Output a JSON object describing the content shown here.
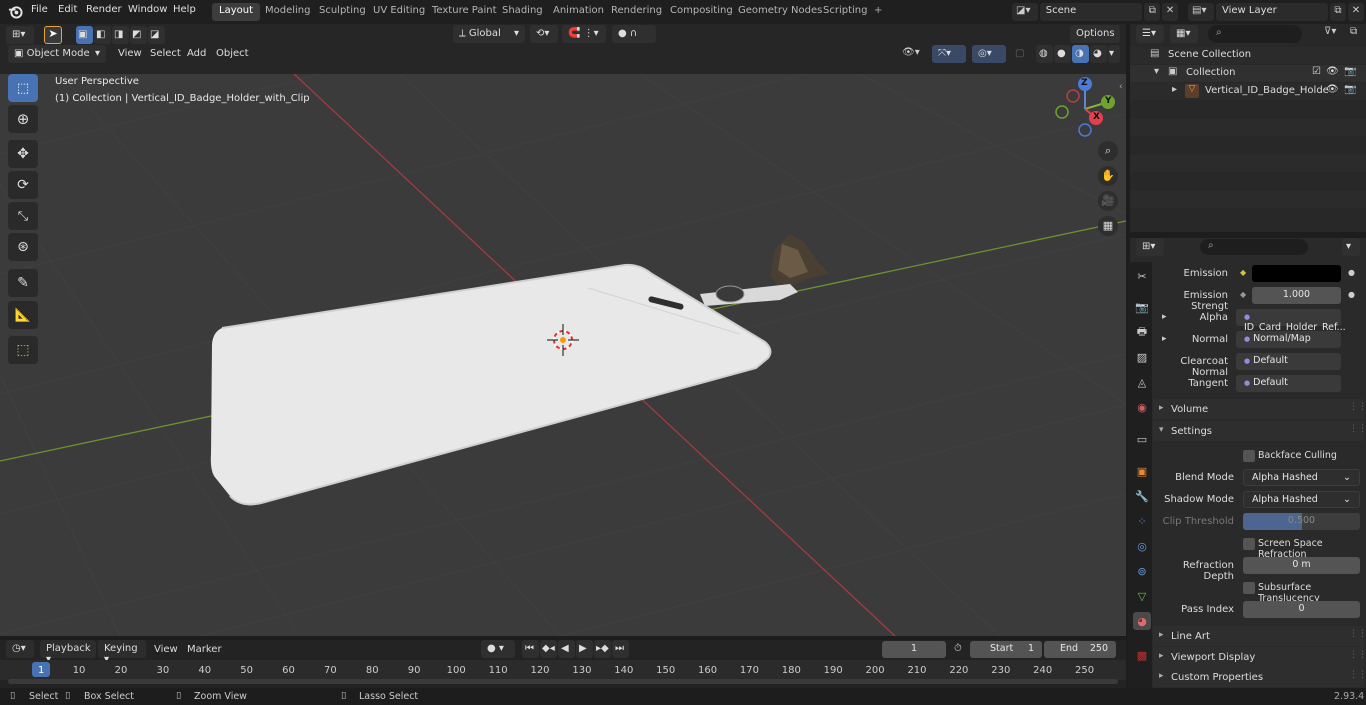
{
  "top_menu": {
    "file": "File",
    "edit": "Edit",
    "render": "Render",
    "window": "Window",
    "help": "Help",
    "workspaces": [
      "Layout",
      "Modeling",
      "Sculpting",
      "UV Editing",
      "Texture Paint",
      "Shading",
      "Animation",
      "Rendering",
      "Compositing",
      "Geometry Nodes",
      "Scripting"
    ],
    "add_tab": "+",
    "scene": "Scene",
    "view_layer": "View Layer"
  },
  "viewport_header": {
    "transform_orientation": "Global",
    "mode": "Object Mode",
    "view": "View",
    "select": "Select",
    "add": "Add",
    "object": "Object",
    "options": "Options"
  },
  "viewport": {
    "perspective": "User Perspective",
    "collection_info": "(1) Collection | Vertical_ID_Badge_Holder_with_Clip",
    "gizmo": {
      "z": "Z",
      "y": "Y",
      "x": "X"
    }
  },
  "outliner": {
    "scene_collection": "Scene Collection",
    "collection": "Collection",
    "object": "Vertical_ID_Badge_Holde"
  },
  "properties": {
    "emission": {
      "label": "Emission",
      "color": "#000000"
    },
    "emission_strength": {
      "label": "Emission Strengt",
      "value": "1.000"
    },
    "alpha": {
      "label": "Alpha",
      "value": "ID_Card_Holder_Ref..."
    },
    "normal": {
      "label": "Normal",
      "value": "Normal/Map"
    },
    "clearcoat_normal": {
      "label": "Clearcoat Normal",
      "value": "Default"
    },
    "tangent": {
      "label": "Tangent",
      "value": "Default"
    },
    "volume": "Volume",
    "settings": "Settings",
    "backface_culling": "Backface Culling",
    "blend_mode": {
      "label": "Blend Mode",
      "value": "Alpha Hashed"
    },
    "shadow_mode": {
      "label": "Shadow Mode",
      "value": "Alpha Hashed"
    },
    "clip_threshold": {
      "label": "Clip Threshold",
      "value": "0.500",
      "fraction": 0.5
    },
    "screen_space_refraction": "Screen Space Refraction",
    "refraction_depth": {
      "label": "Refraction Depth",
      "value": "0 m"
    },
    "subsurface_translucency": "Subsurface Translucency",
    "pass_index": {
      "label": "Pass Index",
      "value": "0"
    },
    "line_art": "Line Art",
    "viewport_display": "Viewport Display",
    "custom_properties": "Custom Properties"
  },
  "timeline": {
    "playback": "Playback",
    "keying": "Keying",
    "view": "View",
    "marker": "Marker",
    "current_frame": "1",
    "start_label": "Start",
    "start_value": "1",
    "end_label": "End",
    "end_value": "250",
    "ruler": [
      "1",
      "10",
      "20",
      "30",
      "40",
      "50",
      "60",
      "70",
      "80",
      "90",
      "100",
      "110",
      "120",
      "130",
      "140",
      "150",
      "160",
      "170",
      "180",
      "190",
      "200",
      "210",
      "220",
      "230",
      "240",
      "250"
    ]
  },
  "status_bar": {
    "select": "Select",
    "box_select": "Box Select",
    "zoom_view": "Zoom View",
    "lasso_select": "Lasso Select",
    "version": "2.93.4"
  },
  "colors": {
    "accent": "#4772b3",
    "x_axis": "#a23b44",
    "y_axis": "#6c9232"
  }
}
